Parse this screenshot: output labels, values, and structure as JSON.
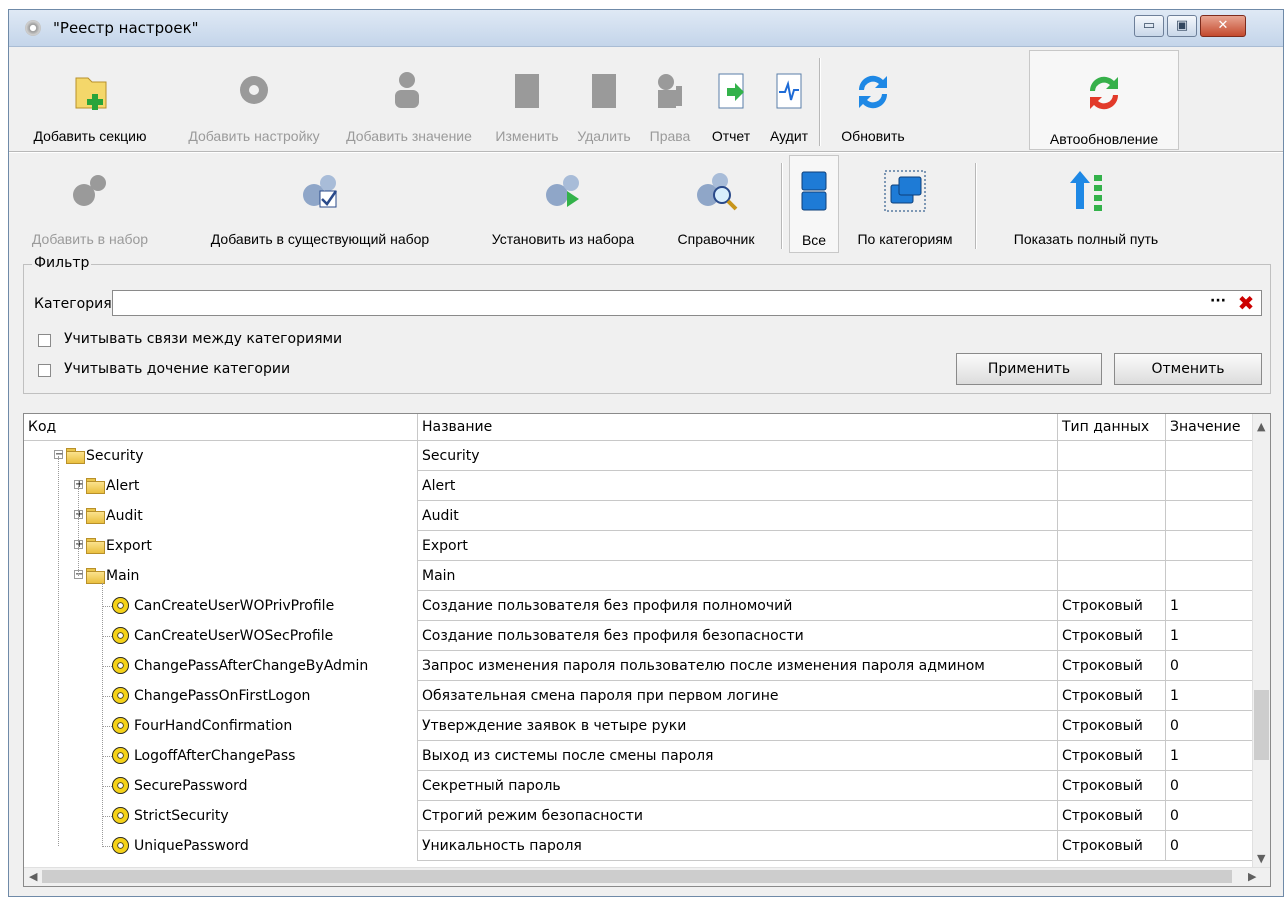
{
  "window": {
    "title": "\"Реестр настроек\"",
    "controls": {
      "minimize": "▭",
      "maximize": "▣",
      "close": "✕"
    }
  },
  "toolbar1": [
    {
      "label": "Добавить секцию",
      "icon": "add-folder-icon",
      "enabled": true
    },
    {
      "label": "Добавить настройку",
      "icon": "add-gear-icon",
      "enabled": false
    },
    {
      "label": "Добавить значение",
      "icon": "add-value-icon",
      "enabled": false
    },
    {
      "label": "Изменить",
      "icon": "edit-icon",
      "enabled": false
    },
    {
      "label": "Удалить",
      "icon": "delete-icon",
      "enabled": false
    },
    {
      "label": "Права",
      "icon": "rights-icon",
      "enabled": false
    },
    {
      "label": "Отчет",
      "icon": "report-icon",
      "enabled": true
    },
    {
      "label": "Аудит",
      "icon": "audit-icon",
      "enabled": true
    },
    {
      "label": "Обновить",
      "icon": "refresh-icon",
      "enabled": true
    },
    {
      "label": "Автообновление",
      "icon": "autorefresh-icon",
      "enabled": true
    }
  ],
  "toolbar2": [
    {
      "label": "Добавить в набор",
      "icon": "add-to-set-icon",
      "enabled": false
    },
    {
      "label": "Добавить в существующий набор",
      "icon": "add-to-existing-set-icon",
      "enabled": true
    },
    {
      "label": "Установить из набора",
      "icon": "install-from-set-icon",
      "enabled": true
    },
    {
      "label": "Справочник",
      "icon": "reference-icon",
      "enabled": true
    },
    {
      "label": "Все",
      "icon": "view-all-icon",
      "enabled": true
    },
    {
      "label": "По категориям",
      "icon": "view-categories-icon",
      "enabled": true
    },
    {
      "label": "Показать полный путь",
      "icon": "full-path-icon",
      "enabled": true
    }
  ],
  "filter": {
    "legend": "Фильтр",
    "category_label": "Категория",
    "category_value": "",
    "browse_button": "···",
    "checkbox1": "Учитывать связи между категориями",
    "checkbox2": "Учитывать дочение категории",
    "apply": "Применить",
    "cancel": "Отменить"
  },
  "grid": {
    "columns": [
      "Код",
      "Название",
      "Тип данных",
      "Значение"
    ],
    "rows": [
      {
        "code": "Security",
        "name": "Security",
        "type": "",
        "value": "",
        "level": 0,
        "kind": "folder",
        "expanded": true
      },
      {
        "code": "Alert",
        "name": "Alert",
        "type": "",
        "value": "",
        "level": 1,
        "kind": "folder",
        "expanded": false
      },
      {
        "code": "Audit",
        "name": "Audit",
        "type": "",
        "value": "",
        "level": 1,
        "kind": "folder",
        "expanded": false
      },
      {
        "code": "Export",
        "name": "Export",
        "type": "",
        "value": "",
        "level": 1,
        "kind": "folder",
        "expanded": false
      },
      {
        "code": "Main",
        "name": "Main",
        "type": "",
        "value": "",
        "level": 1,
        "kind": "folder",
        "expanded": true
      },
      {
        "code": "CanCreateUserWOPrivProfile",
        "name": "Создание пользователя без профиля полномочий",
        "type": "Строковый",
        "value": "1",
        "level": 2,
        "kind": "setting"
      },
      {
        "code": "CanCreateUserWOSecProfile",
        "name": "Создание пользователя без профиля безопасности",
        "type": "Строковый",
        "value": "1",
        "level": 2,
        "kind": "setting"
      },
      {
        "code": "ChangePassAfterChangeByAdmin",
        "name": "Запрос изменения пароля пользователю после изменения пароля админом",
        "type": "Строковый",
        "value": "0",
        "level": 2,
        "kind": "setting"
      },
      {
        "code": "ChangePassOnFirstLogon",
        "name": "Обязательная смена пароля при первом логине",
        "type": "Строковый",
        "value": "1",
        "level": 2,
        "kind": "setting"
      },
      {
        "code": "FourHandConfirmation",
        "name": "Утверждение заявок в четыре руки",
        "type": "Строковый",
        "value": "0",
        "level": 2,
        "kind": "setting"
      },
      {
        "code": "LogoffAfterChangePass",
        "name": "Выход из системы после смены пароля",
        "type": "Строковый",
        "value": "1",
        "level": 2,
        "kind": "setting"
      },
      {
        "code": "SecurePassword",
        "name": "Секретный пароль",
        "type": "Строковый",
        "value": "0",
        "level": 2,
        "kind": "setting"
      },
      {
        "code": "StrictSecurity",
        "name": "Строгий режим безопасности",
        "type": "Строковый",
        "value": "0",
        "level": 2,
        "kind": "setting"
      },
      {
        "code": "UniquePassword",
        "name": "Уникальность пароля",
        "type": "Строковый",
        "value": "0",
        "level": 2,
        "kind": "setting"
      }
    ]
  },
  "colors": {
    "accent_blue": "#1e7bd6",
    "disabled_gray": "#9a9a9a",
    "close_red": "#cc0000",
    "folder_yellow": "#f1cf5a"
  }
}
